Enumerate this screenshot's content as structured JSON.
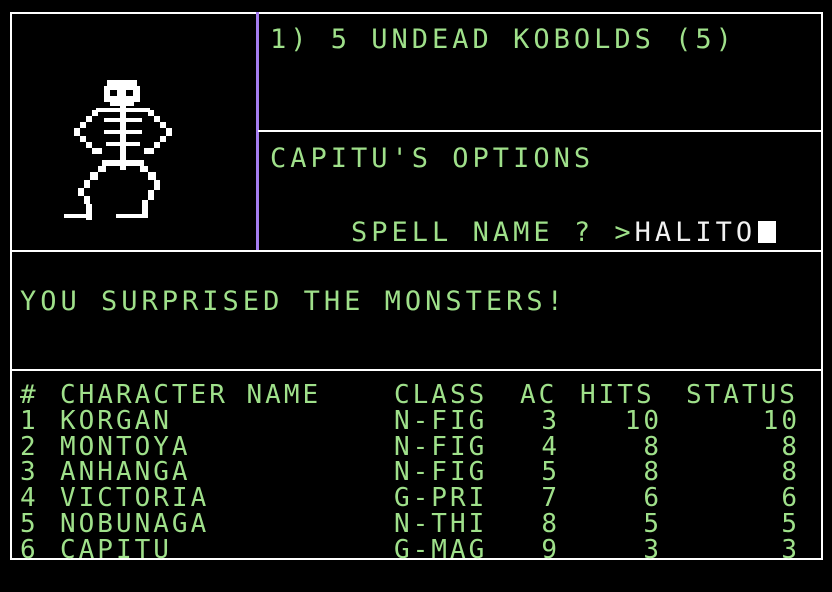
{
  "encounter": {
    "text": "1) 5 UNDEAD KOBOLDS (5)"
  },
  "options": {
    "title": "CAPITU'S OPTIONS",
    "prompt": "SPELL NAME ? >",
    "input_value": "HALITO"
  },
  "message": {
    "text": "YOU SURPRISED THE MONSTERS!"
  },
  "monster": {
    "icon": "skeleton-icon"
  },
  "party": {
    "headers": {
      "num": "#",
      "name": "CHARACTER NAME",
      "class": "CLASS",
      "ac": "AC",
      "hits": "HITS",
      "status": "STATUS"
    },
    "members": [
      {
        "num": "1",
        "name": "KORGAN",
        "class": "N-FIG",
        "ac": "3",
        "hits": "10",
        "status": "10"
      },
      {
        "num": "2",
        "name": "MONTOYA",
        "class": "N-FIG",
        "ac": "4",
        "hits": "8",
        "status": "8"
      },
      {
        "num": "3",
        "name": "ANHANGA",
        "class": "N-FIG",
        "ac": "5",
        "hits": "8",
        "status": "8"
      },
      {
        "num": "4",
        "name": "VICTORIA",
        "class": "G-PRI",
        "ac": "7",
        "hits": "6",
        "status": "6"
      },
      {
        "num": "5",
        "name": "NOBUNAGA",
        "class": "N-THI",
        "ac": "8",
        "hits": "5",
        "status": "5"
      },
      {
        "num": "6",
        "name": "CAPITU",
        "class": "G-MAG",
        "ac": "9",
        "hits": "3",
        "status": "3"
      }
    ]
  },
  "colors": {
    "background": "#000000",
    "text_green": "#9fe08a",
    "text_white": "#f2f2f2",
    "border_white": "#ffffff",
    "border_purple": "#a57ef0"
  }
}
